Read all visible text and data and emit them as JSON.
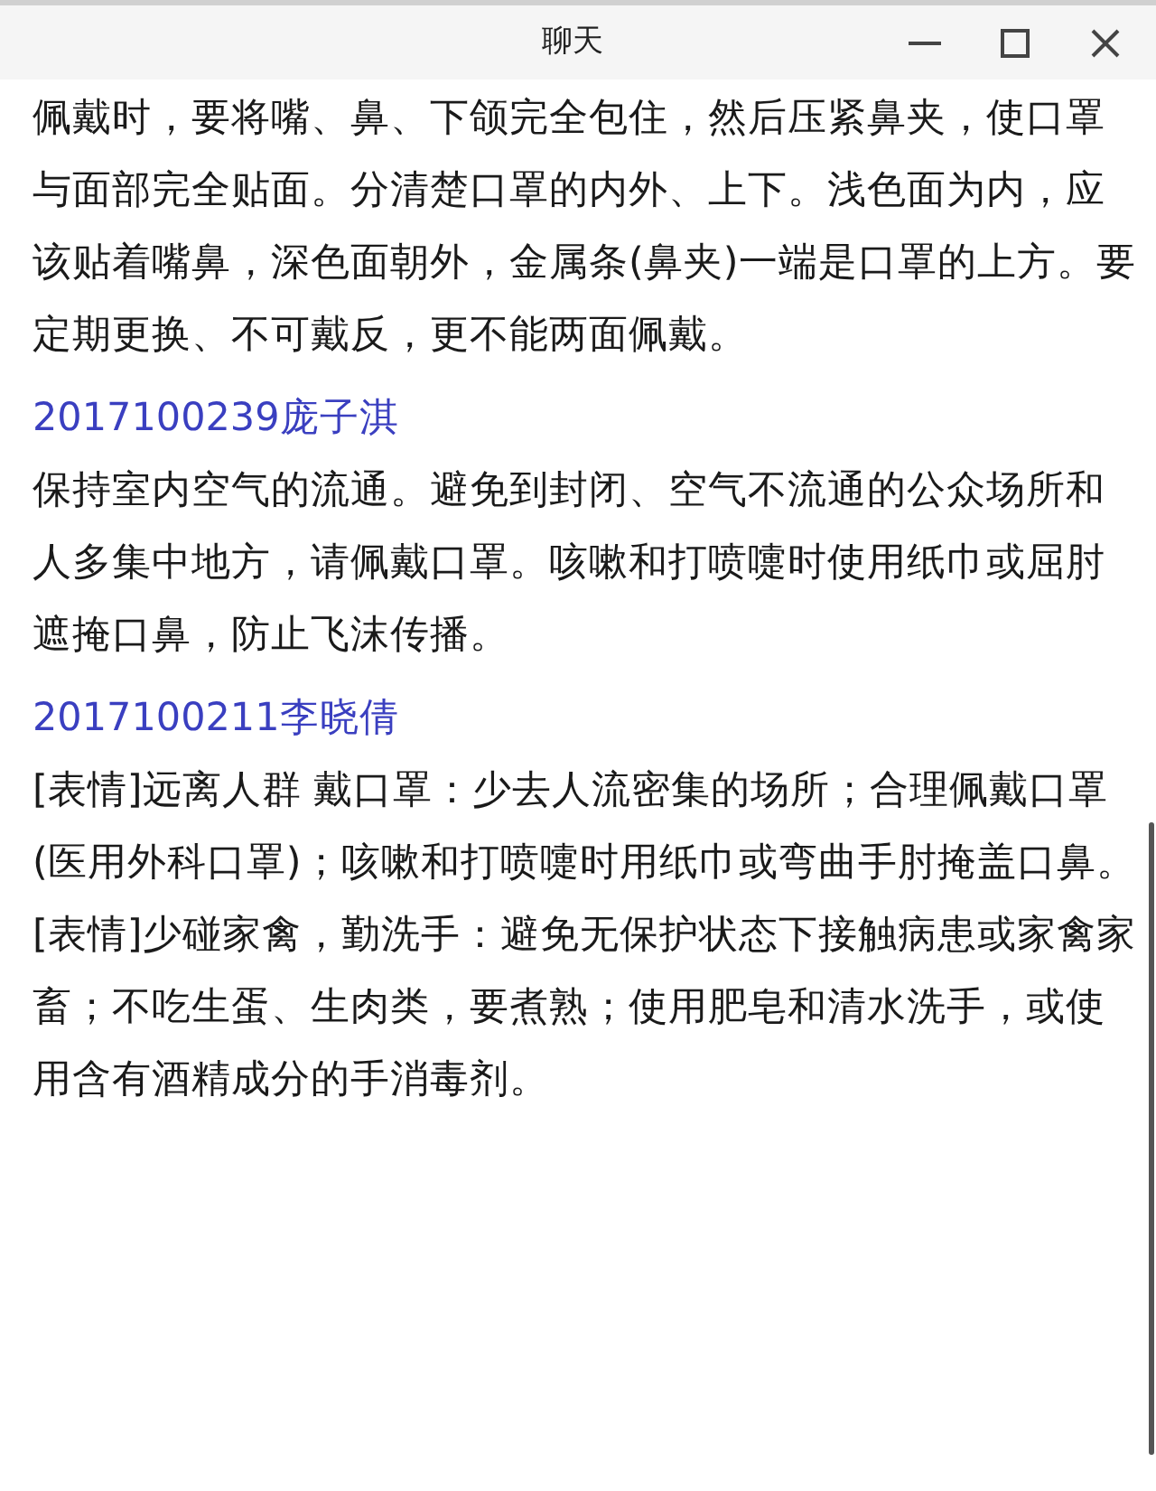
{
  "window": {
    "title": "聊天"
  },
  "messages": [
    {
      "paragraphs": [
        "佩戴时，要将嘴、鼻、下颌完全包住，然后压紧鼻夹，使口罩与面部完全贴面。分清楚口罩的内外、上下。浅色面为内，应该贴着嘴鼻，深色面朝外，金属条(鼻夹)一端是口罩的上方。要定期更换、不可戴反，更不能两面佩戴。"
      ]
    },
    {
      "sender": "2017100239庞子淇",
      "paragraphs": [
        "保持室内空气的流通。避免到封闭、空气不流通的公众场所和人多集中地方，请佩戴口罩。咳嗽和打喷嚏时使用纸巾或屈肘遮掩口鼻，防止飞沫传播。"
      ]
    },
    {
      "sender": "2017100211李晓倩",
      "paragraphs": [
        "[表情]远离人群 戴口罩：少去人流密集的场所；合理佩戴口罩(医用外科口罩)；咳嗽和打喷嚏时用纸巾或弯曲手肘掩盖口鼻。",
        "[表情]少碰家禽，勤洗手：避免无保护状态下接触病患或家禽家畜；不吃生蛋、生肉类，要煮熟；使用肥皂和清水洗手，或使用含有酒精成分的手消毒剂。"
      ]
    }
  ]
}
